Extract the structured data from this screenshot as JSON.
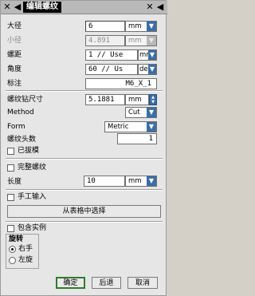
{
  "titlebar": {
    "title": "编辑螺纹",
    "close_glyph": "✕",
    "back_glyph": "◀",
    "pin_glyph": "✕",
    "right_glyph": "◀"
  },
  "fields": {
    "major_diameter": {
      "label": "大径",
      "value": "6",
      "unit": "mm"
    },
    "minor_diameter": {
      "label": "小径",
      "value": "4.891",
      "unit": "mm"
    },
    "pitch": {
      "label": "螺距",
      "value": "1 // Use",
      "unit": "mm"
    },
    "angle": {
      "label": "角度",
      "value": "60 // Us",
      "unit": "deg"
    },
    "callout": {
      "label": "标注",
      "value": "M6_X_1"
    },
    "tap_drill": {
      "label": "螺纹钻尺寸",
      "value": "5.1881",
      "unit": "mm"
    },
    "method": {
      "label": "Method",
      "value": "Cut"
    },
    "form": {
      "label": "Form",
      "value": "Metric"
    },
    "starts": {
      "label": "螺纹头数",
      "value": "1"
    },
    "length": {
      "label": "长度",
      "value": "10",
      "unit": "mm"
    }
  },
  "checkboxes": {
    "tapered": "已拔模",
    "full_thread": "完整螺纹",
    "manual_input": "手工输入",
    "include_instances": "包含实例"
  },
  "select_from_table": "从表格中选择",
  "rotation": {
    "title": "旋转",
    "right_hand": "右手",
    "left_hand": "左旋"
  },
  "buttons": {
    "ok": "确定",
    "back": "后退",
    "cancel": "取消"
  }
}
